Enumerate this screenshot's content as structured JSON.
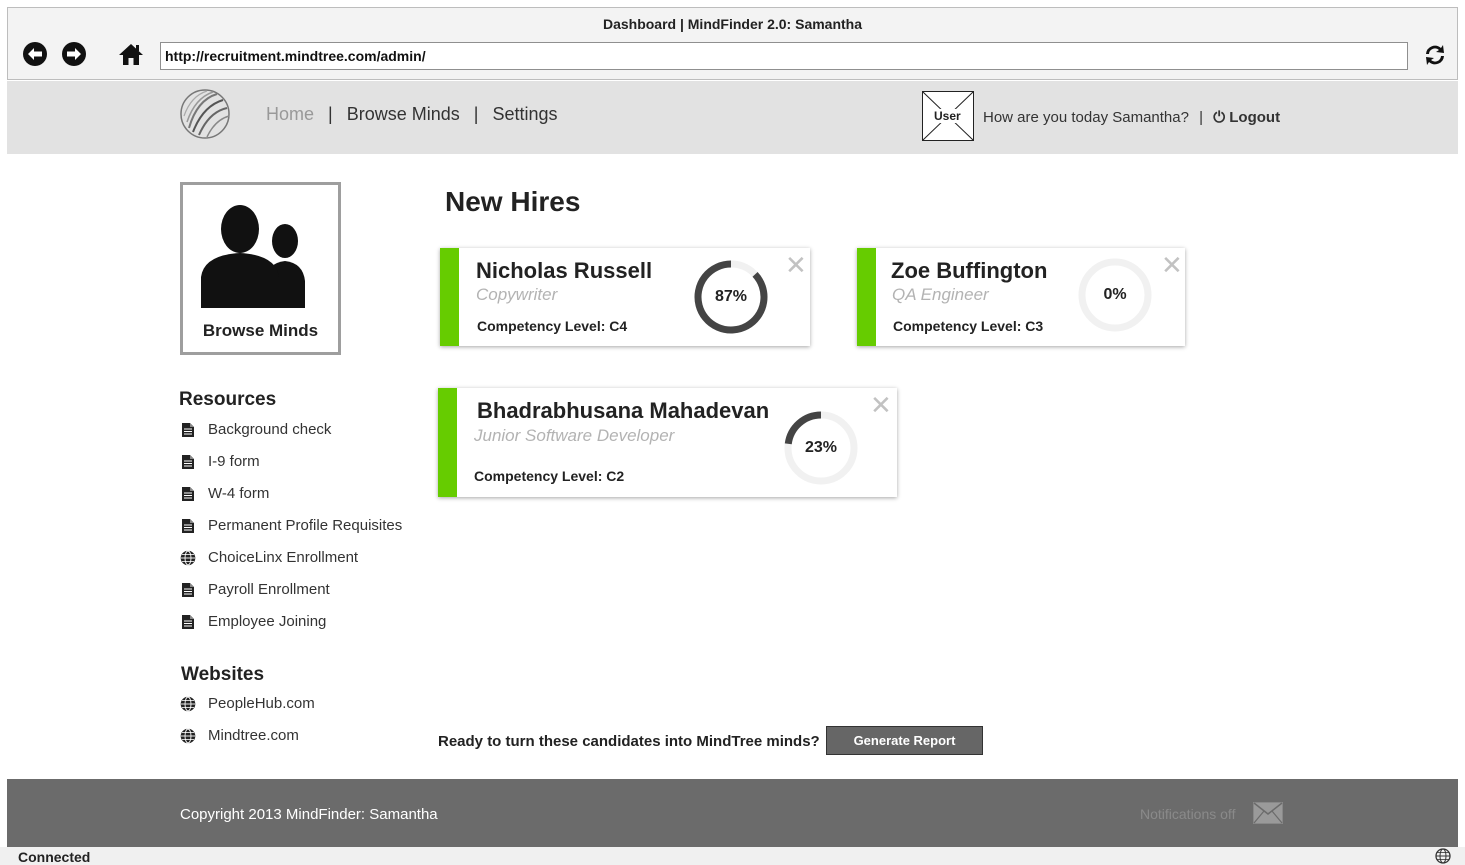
{
  "browser": {
    "title": "Dashboard | MindFinder 2.0: Samantha",
    "url": "http://recruitment.mindtree.com/admin/",
    "status": "Connected"
  },
  "nav": {
    "home": "Home",
    "sep1": "|",
    "browse": "Browse Minds",
    "sep2": "|",
    "settings": "Settings"
  },
  "user": {
    "avatar_label": "User",
    "greeting": "How are you today Samantha?",
    "sep": "|",
    "logout": "Logout"
  },
  "sidebar": {
    "browse_card_label": "Browse Minds",
    "resources_heading": "Resources",
    "resources": [
      {
        "label": "Background check",
        "icon": "document-icon"
      },
      {
        "label": "I-9 form",
        "icon": "document-icon"
      },
      {
        "label": "W-4 form",
        "icon": "document-icon"
      },
      {
        "label": "Permanent Profile Requisites",
        "icon": "document-icon"
      },
      {
        "label": "ChoiceLinx Enrollment",
        "icon": "globe-icon"
      },
      {
        "label": "Payroll Enrollment",
        "icon": "document-icon"
      },
      {
        "label": "Employee Joining",
        "icon": "document-icon"
      }
    ],
    "websites_heading": "Websites",
    "websites": [
      {
        "label": "PeopleHub.com",
        "icon": "globe-icon"
      },
      {
        "label": "Mindtree.com",
        "icon": "globe-icon"
      }
    ]
  },
  "main": {
    "title": "New Hires",
    "hires": [
      {
        "name": "Nicholas Russell",
        "role": "Copywriter",
        "level": "Competency Level: C4",
        "progress": 87,
        "progress_label": "87%"
      },
      {
        "name": "Zoe Buffington",
        "role": "QA Engineer",
        "level": "Competency Level: C3",
        "progress": 0,
        "progress_label": "0%"
      },
      {
        "name": "Bhadrabhusana Mahadevan",
        "role": "Junior Software Developer",
        "level": "Competency Level: C2",
        "progress": 23,
        "progress_label": "23%"
      }
    ],
    "ready_text": "Ready to turn these candidates into MindTree minds?",
    "generate_button": "Generate Report"
  },
  "footer": {
    "copyright": "Copyright 2013 MindFinder: Samantha",
    "notifications": "Notifications off"
  },
  "colors": {
    "accent_green": "#66cc00",
    "header_gray": "#e2e2e2",
    "footer_gray": "#6b6b6b",
    "button_gray": "#666666"
  }
}
